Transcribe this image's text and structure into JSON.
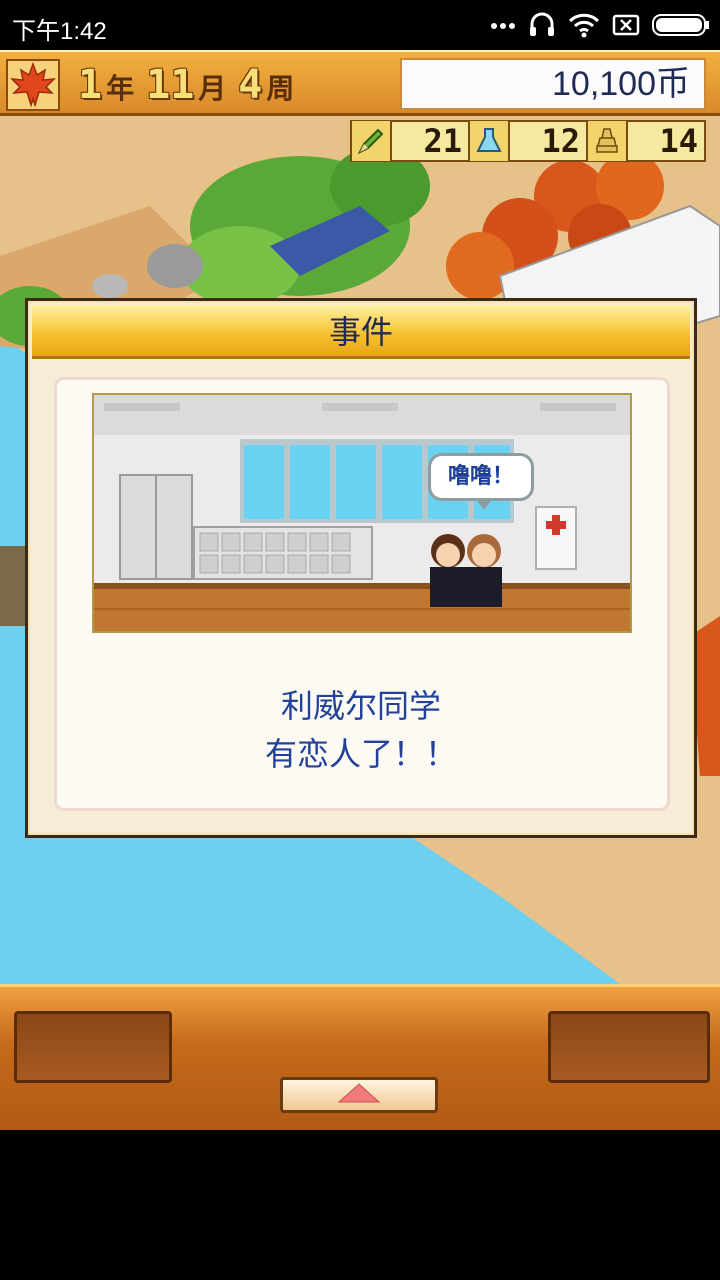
{
  "status_bar": {
    "time": "下午1:42",
    "icons": [
      "more-dots-icon",
      "headset-icon",
      "wifi-icon",
      "sim-x-icon",
      "battery-icon"
    ]
  },
  "hud": {
    "season_icon": "maple-leaf-icon",
    "year": "1",
    "year_unit": "年",
    "month": "11",
    "month_unit": "月",
    "week": "4",
    "week_unit": "周",
    "money": "10,100币"
  },
  "stats": [
    {
      "icon": "pencil-icon",
      "value": "21"
    },
    {
      "icon": "flask-icon",
      "value": "12"
    },
    {
      "icon": "trophy-icon",
      "value": "14"
    }
  ],
  "dialog": {
    "title": "事件",
    "speech_bubble": "噜噜！",
    "message_line1": "利威尔同学",
    "message_line2": "有恋人了！！"
  },
  "bottom_bar": {
    "up_button_icon": "triangle-up-icon"
  },
  "colors": {
    "hud_orange": "#e39a33",
    "dialog_title_yellow": "#f6c02c",
    "message_blue": "#22429a",
    "water": "#6cd0ee"
  }
}
